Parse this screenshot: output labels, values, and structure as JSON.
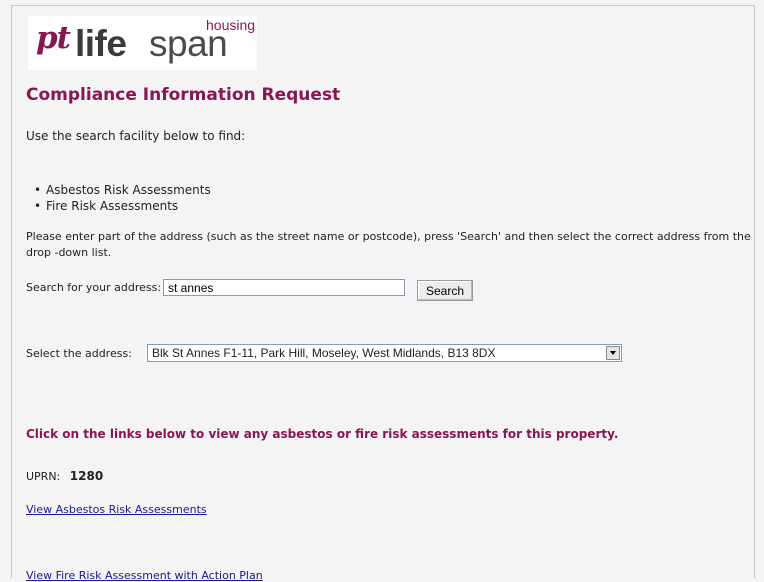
{
  "header": {
    "logo_pt": "pt",
    "logo_life": "life",
    "logo_span": "span",
    "logo_housing": "housing"
  },
  "page": {
    "title": "Compliance Information Request",
    "intro": "Use the search facility below to find:",
    "bullets": [
      "Asbestos Risk Assessments",
      "Fire Risk Assessments"
    ],
    "bullet_glyph": "•",
    "instructions": "Please enter part of the address (such as the street name or postcode), press 'Search' and then select the correct address from the drop -down list."
  },
  "search": {
    "label": "Search for your address:",
    "value": "st annes",
    "button_label": "Search"
  },
  "address_select": {
    "label": "Select the address:",
    "selected": "Blk St Annes F1-11, Park Hill, Moseley, West Midlands, B13 8DX"
  },
  "results": {
    "heading": "Click on the links below to view any asbestos or fire risk assessments for this property.",
    "uprn_label": "UPRN:",
    "uprn_value": "1280",
    "link_asbestos": "View Asbestos Risk Assessments",
    "link_fire": "View Fire Risk Assessment with Action Plan"
  },
  "colors": {
    "accent": "#8a1650",
    "link": "#1a1a8a",
    "background": "#f4f4f4"
  }
}
